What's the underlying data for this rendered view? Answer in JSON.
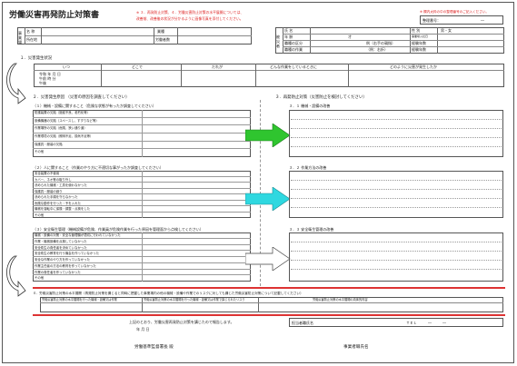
{
  "title": "労働災害再発防止対策書",
  "red_note_left": [
    "※ ３．再発防止対策、４．労働災害防止対策の水平展開については、",
    "改善前、改善後の状況が分かるように画像写真を添付してください。"
  ],
  "red_note_right": "※ 欄内太枠の中の整理番号のご記入ください。",
  "ref_number": {
    "label": "整理番号：",
    "value": "―"
  },
  "company_table": {
    "r1": [
      "事業場",
      "名 称",
      "業種"
    ],
    "r2": [
      "所在地",
      "労働者数"
    ]
  },
  "victim_table": {
    "side": "被災者",
    "rows": [
      [
        "氏 名",
        "",
        "性 別",
        "男・女"
      ],
      [
        "年 齢",
        "才",
        "事業場入社日",
        ""
      ],
      [
        "職種の区分",
        "例（右手の親指）",
        "経験年数",
        ""
      ],
      [
        "職種の作業",
        "（例：右折）",
        "経験年数",
        ""
      ]
    ]
  },
  "sec1": {
    "heading": "１．災害発生状況",
    "cols": [
      "いつ",
      "どこで",
      "だれが",
      "どんな作業をしているときに",
      "どのように災害が発生したか"
    ],
    "when": [
      "令和 年 月 日",
      "午前 時 分",
      "午後"
    ]
  },
  "sec2": {
    "heading": "２．災害発生原因 （災害の原因を調査してください）",
    "sub1": "（１）機械・設備に関すること（危険な状態が有ったか調査してください）",
    "items1": [
      "防護装置の欠陥（施錠不良、老朽化等）",
      "設備機器の欠陥（スペースし、すすりなど等）",
      "作業場所の欠陥（危険、狭い通り道）",
      "作業環境の欠陥（照明不足、換気不足等）",
      "保護具・服装の欠陥",
      "その他"
    ],
    "sub2": "（２）人に関すること（作業のやり方に不適切な事がったか調査してください）",
    "items2": [
      "安全装置の不使用",
      "カバー、ネオ等の取り外し",
      "決められた機械・工具を使わなかった",
      "保護具・服装の誤り",
      "決められた手順を守らなかった",
      "危険な動作を行った・予を入れた",
      "機械を運転中に保険・調整・点検をした",
      "その他"
    ],
    "sub3": "（３）安全衛生管理（機械設備が危険、作業員が危険作業を行った原因を管理面から点検してください）",
    "items3": [
      "機械・設備の対策・安全な管理機が適切に行われていなかった",
      "作業・機械設備を点検していなかった",
      "安全衛生の責任者を決めていなかった",
      "安全衛生の教育を行う機会を作っていなかった",
      "安全な作業のやり方を作っていなかった",
      "作業主任者の方法の教育を作っていなかった",
      "作業の責任者を作っていなかった",
      "その他"
    ]
  },
  "sec3": {
    "heading": "３．再発防止対策（災害防止を検討してください）",
    "sub1": "３．１ 機械・設備の改善",
    "sub2": "３．２ 作業方法の改善",
    "sub3": "３．３ 安全衛生管理の改善"
  },
  "sec4": {
    "heading": "４．労働災害防止対策の水平展開（再発防止対策を講じると同時に把握した事業場内の他の機械・設備や作業でのリスクに対しても講じた労働災害防止対策について記載してください）",
    "cols": [
      "労働災害防止対策の水平展開を行った機械・設備又は作業",
      "労働災害防止対策の水平展開を行った機械・設備又は作業で講じられたリスク",
      "労働災害防止対策の水平展開の具体的内容"
    ]
  },
  "footer": {
    "line1": "上記のとおり、労働災害再発防止対策を講じたので報告します。",
    "date": "年 月 日",
    "recipient": "労働基準監督署長 殿",
    "employer": "事業者職氏名",
    "reporter": "担当者職氏名",
    "tel": "ＴＥＬ　　　―　　　―"
  },
  "colors": {
    "accent_red": "#d22222",
    "arrow_green": "#2fc52f",
    "arrow_cyan": "#2fd8e0",
    "arrow_white": "#ffffff"
  }
}
